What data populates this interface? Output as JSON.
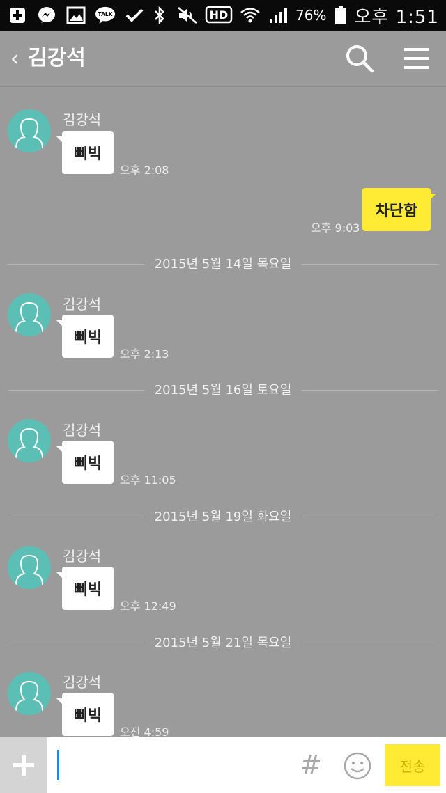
{
  "status_bar": {
    "battery": "76%",
    "time": "오후 1:51",
    "icons": [
      "add-icon",
      "messenger-icon",
      "image-icon",
      "talk-icon",
      "check-icon",
      "bluetooth-icon",
      "mute-icon",
      "hd-icon",
      "wifi-icon",
      "signal-icon",
      "battery-icon"
    ],
    "talk_label": "TALK",
    "hd_label": "HD"
  },
  "header": {
    "title": "김강석",
    "back_glyph": "‹"
  },
  "sender_name": "김강석",
  "messages": [
    {
      "text": "삐빅",
      "time": "오후 2:08"
    },
    {
      "text": "삐빅",
      "time": "오후 2:13"
    },
    {
      "text": "삐빅",
      "time": "오후 11:05"
    },
    {
      "text": "삐빅",
      "time": "오후 12:49"
    },
    {
      "text": "삐빅",
      "time": "오전 4:59"
    }
  ],
  "outgoing": {
    "text": "차단함",
    "time": "오후 9:03"
  },
  "dates": [
    "2015년 5월 14일 목요일",
    "2015년 5월 16일 토요일",
    "2015년 5월 19일 화요일",
    "2015년 5월 21일 목요일"
  ],
  "input_bar": {
    "plus": "+",
    "hash": "#",
    "send_label": "전송",
    "placeholder": ""
  },
  "colors": {
    "background": "#9b9b9b",
    "accent_yellow": "#ffeb33",
    "avatar": "#5bbfb5"
  }
}
